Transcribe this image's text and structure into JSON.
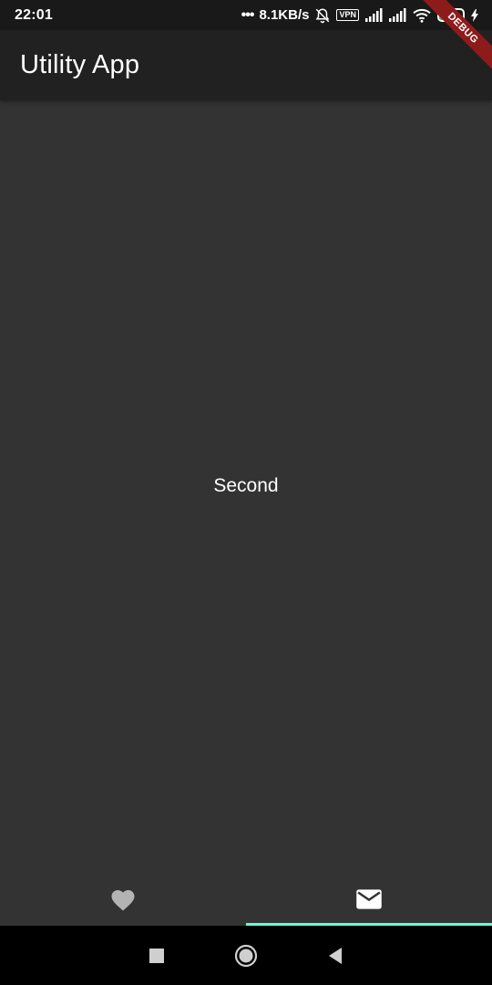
{
  "status_bar": {
    "time": "22:01",
    "network_speed": "8.1KB/s",
    "vpn_label": "VPN",
    "battery_level": "53",
    "battery_fraction": 0.53
  },
  "debug_banner": "DEBUG",
  "app_bar": {
    "title": "Utility App"
  },
  "content": {
    "text": "Second"
  },
  "tabs": [
    {
      "icon": "heart-icon",
      "selected": false
    },
    {
      "icon": "mail-icon",
      "selected": true
    }
  ],
  "colors": {
    "background": "#333333",
    "app_bar": "#212121",
    "tab_indicator": "#64ffda",
    "debug_ribbon": "#8e1b1b"
  }
}
